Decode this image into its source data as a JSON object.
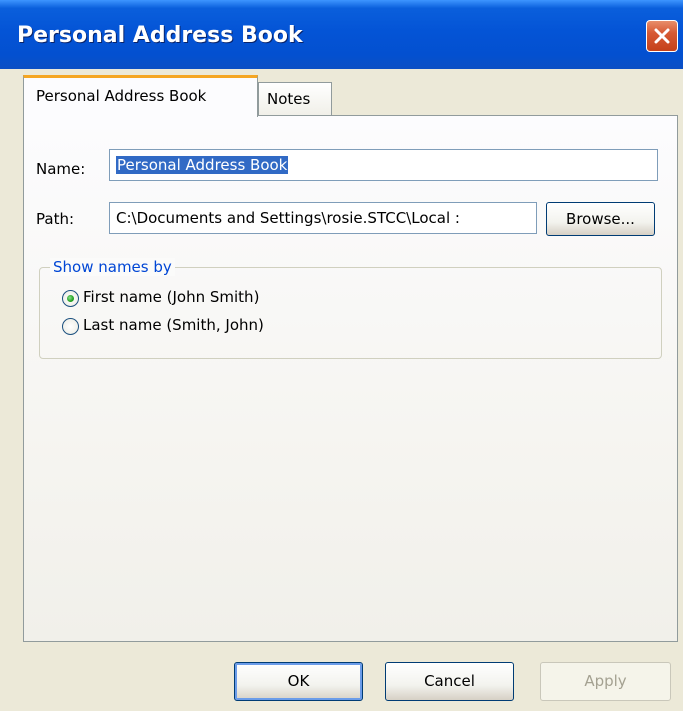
{
  "window": {
    "title": "Personal Address Book"
  },
  "tabs": [
    {
      "label": "Personal Address Book",
      "active": true
    },
    {
      "label": "Notes",
      "active": false
    }
  ],
  "form": {
    "name_label": "Name:",
    "name_value": "Personal Address Book",
    "path_label": "Path:",
    "path_value": "C:\\Documents and Settings\\rosie.STCC\\Local :",
    "browse_label": "Browse..."
  },
  "show_names": {
    "legend": "Show names by",
    "options": [
      {
        "label": "First name (John Smith)",
        "selected": true
      },
      {
        "label": "Last name (Smith, John)",
        "selected": false
      }
    ]
  },
  "buttons": {
    "ok": "OK",
    "cancel": "Cancel",
    "apply": "Apply"
  },
  "colors": {
    "titlebar": "#0454d6",
    "selection": "#316ac5",
    "group_legend": "#0046d5",
    "active_tab_accent": "#f5a623",
    "close_button": "#d75a34"
  }
}
